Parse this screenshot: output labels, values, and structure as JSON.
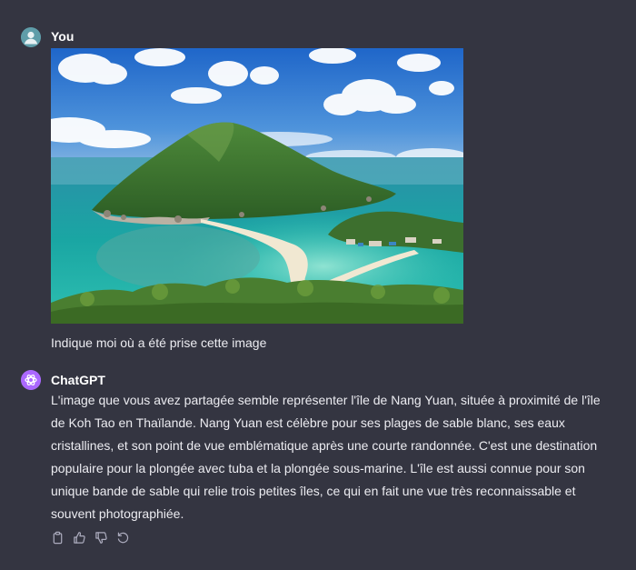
{
  "colors": {
    "background": "#343541",
    "user_avatar": "#5f9da9",
    "assistant_avatar": "#ab68ff",
    "text": "#ececf1",
    "icon": "#acacbe"
  },
  "user_message": {
    "author": "You",
    "avatar_icon": "user-icon",
    "image_description": "tropical-island-photo",
    "text": "Indique moi où a été prise cette image"
  },
  "assistant_message": {
    "author": "ChatGPT",
    "avatar_icon": "openai-logo-icon",
    "lines": [
      "L'image que vous avez partagée semble représenter l'île de Nang Yuan, située à proximité de l'île",
      "de Koh Tao en Thaïlande. Nang Yuan est célèbre pour ses plages de sable blanc, ses eaux",
      "cristallines, et son point de vue emblématique après une courte randonnée. C'est une destination",
      "populaire pour la plongée avec tuba et la plongée sous-marine. L'île est aussi connue pour son",
      "unique bande de sable qui relie trois petites îles, ce qui en fait une vue très reconnaissable et",
      "souvent photographiée."
    ],
    "actions": [
      "copy-icon",
      "thumbs-up-icon",
      "thumbs-down-icon",
      "regenerate-icon"
    ]
  }
}
